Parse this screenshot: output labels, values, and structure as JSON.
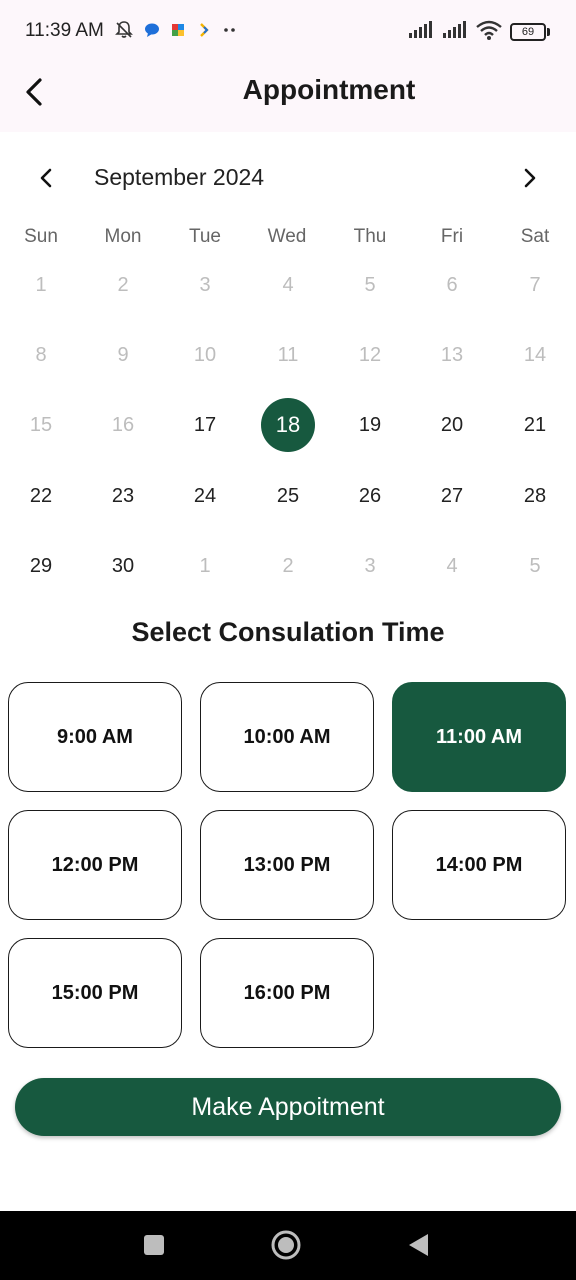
{
  "status_bar": {
    "time": "11:39 AM",
    "icons": [
      "bell-off-icon",
      "chat-icon",
      "puzzle-icon",
      "app-icon",
      "more-icon"
    ],
    "right_icons": [
      "signal-icon",
      "signal-icon",
      "wifi-icon",
      "battery-icon"
    ],
    "battery_level": "69"
  },
  "app_bar": {
    "title": "Appointment",
    "back_icon": "chevron-left-icon"
  },
  "calendar": {
    "month_label": "September 2024",
    "weekdays": [
      "Sun",
      "Mon",
      "Tue",
      "Wed",
      "Thu",
      "Fri",
      "Sat"
    ],
    "weeks": [
      [
        {
          "d": "1",
          "muted": true
        },
        {
          "d": "2",
          "muted": true
        },
        {
          "d": "3",
          "muted": true
        },
        {
          "d": "4",
          "muted": true
        },
        {
          "d": "5",
          "muted": true
        },
        {
          "d": "6",
          "muted": true
        },
        {
          "d": "7",
          "muted": true
        }
      ],
      [
        {
          "d": "8",
          "muted": true
        },
        {
          "d": "9",
          "muted": true
        },
        {
          "d": "10",
          "muted": true
        },
        {
          "d": "11",
          "muted": true
        },
        {
          "d": "12",
          "muted": true
        },
        {
          "d": "13",
          "muted": true
        },
        {
          "d": "14",
          "muted": true
        }
      ],
      [
        {
          "d": "15",
          "muted": true
        },
        {
          "d": "16",
          "muted": true
        },
        {
          "d": "17",
          "muted": false
        },
        {
          "d": "18",
          "muted": false,
          "selected": true
        },
        {
          "d": "19",
          "muted": false
        },
        {
          "d": "20",
          "muted": false
        },
        {
          "d": "21",
          "muted": false
        }
      ],
      [
        {
          "d": "22",
          "muted": false
        },
        {
          "d": "23",
          "muted": false
        },
        {
          "d": "24",
          "muted": false
        },
        {
          "d": "25",
          "muted": false
        },
        {
          "d": "26",
          "muted": false
        },
        {
          "d": "27",
          "muted": false
        },
        {
          "d": "28",
          "muted": false
        }
      ],
      [
        {
          "d": "29",
          "muted": false
        },
        {
          "d": "30",
          "muted": false
        },
        {
          "d": "1",
          "muted": true
        },
        {
          "d": "2",
          "muted": true
        },
        {
          "d": "3",
          "muted": true
        },
        {
          "d": "4",
          "muted": true
        },
        {
          "d": "5",
          "muted": true
        }
      ]
    ],
    "selected_day": "18"
  },
  "time_section": {
    "title": "Select Consulation Time",
    "slots": [
      {
        "label": "9:00 AM",
        "selected": false
      },
      {
        "label": "10:00 AM",
        "selected": false
      },
      {
        "label": "11:00 AM",
        "selected": true
      },
      {
        "label": "12:00 PM",
        "selected": false
      },
      {
        "label": "13:00 PM",
        "selected": false
      },
      {
        "label": "14:00 PM",
        "selected": false
      },
      {
        "label": "15:00 PM",
        "selected": false
      },
      {
        "label": "16:00 PM",
        "selected": false
      }
    ]
  },
  "actions": {
    "make_appointment_label": "Make Appoitment"
  },
  "colors": {
    "accent": "#17593f",
    "muted_text": "#bdbdbd",
    "header_bg": "#fdf7fb"
  },
  "nav_bar": {
    "buttons": [
      "recents-square-icon",
      "home-circle-icon",
      "back-triangle-icon"
    ]
  }
}
